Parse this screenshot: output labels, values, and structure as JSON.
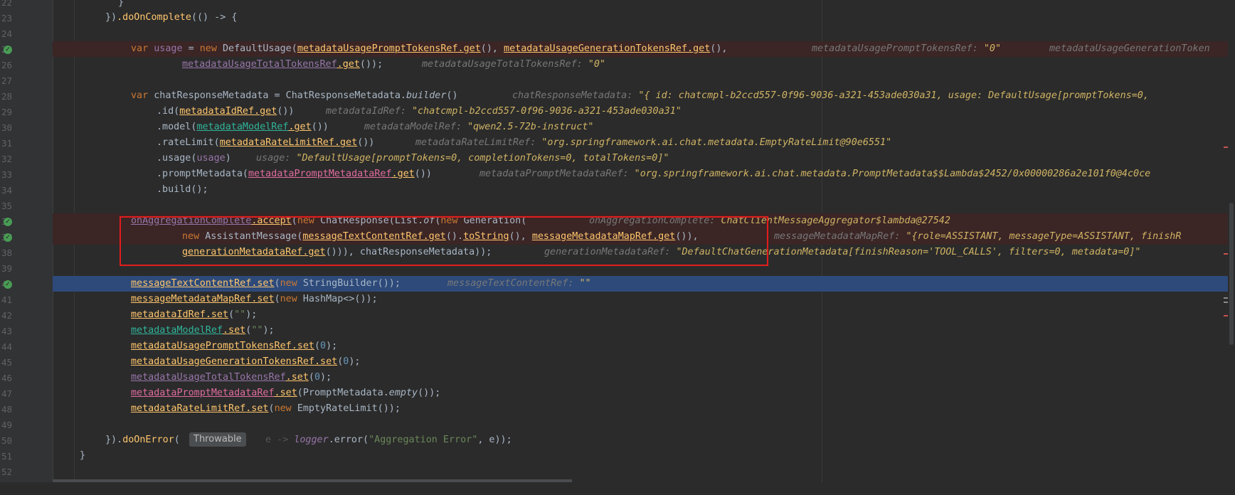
{
  "gutter": {
    "lines": [
      {
        "n": "22",
        "bp": false
      },
      {
        "n": "23",
        "bp": false
      },
      {
        "n": "24",
        "bp": false
      },
      {
        "n": "25",
        "bp": true
      },
      {
        "n": "26",
        "bp": false
      },
      {
        "n": "27",
        "bp": false
      },
      {
        "n": "28",
        "bp": false
      },
      {
        "n": "29",
        "bp": false
      },
      {
        "n": "30",
        "bp": false
      },
      {
        "n": "31",
        "bp": false
      },
      {
        "n": "32",
        "bp": false
      },
      {
        "n": "33",
        "bp": false
      },
      {
        "n": "34",
        "bp": false
      },
      {
        "n": "35",
        "bp": false
      },
      {
        "n": "36",
        "bp": true
      },
      {
        "n": "37",
        "bp": true
      },
      {
        "n": "38",
        "bp": false
      },
      {
        "n": "39",
        "bp": false
      },
      {
        "n": "40",
        "bp": true
      },
      {
        "n": "41",
        "bp": false
      },
      {
        "n": "42",
        "bp": false
      },
      {
        "n": "43",
        "bp": false
      },
      {
        "n": "44",
        "bp": false
      },
      {
        "n": "45",
        "bp": false
      },
      {
        "n": "46",
        "bp": false
      },
      {
        "n": "47",
        "bp": false
      },
      {
        "n": "48",
        "bp": false
      },
      {
        "n": "49",
        "bp": false
      },
      {
        "n": "50",
        "bp": false
      },
      {
        "n": "51",
        "bp": false
      },
      {
        "n": "52",
        "bp": false
      }
    ]
  },
  "code": {
    "l22": "}",
    "l23_a": "})",
    "l23_b": ".doOnComplete",
    "l23_c": "(() -> {",
    "l25_var": "var ",
    "l25_usage": "usage",
    "l25_eq": " = ",
    "l25_new": "new ",
    "l25_cls": "DefaultUsage(",
    "l25_f1": "metadataUsagePromptTokensRef",
    "l25_g1": ".get",
    "l25_p1": "(), ",
    "l25_f2": "metadataUsageGenerationTokensRef",
    "l25_g2": ".get",
    "l25_p2": "(),",
    "l25_h1": "metadataUsagePromptTokensRef: ",
    "l25_v1": "\"0\"",
    "l25_h2": "metadataUsageGenerationToken",
    "l26_f": "metadataUsageTotalTokensRef",
    "l26_g": ".get",
    "l26_p": "());",
    "l26_h": "metadataUsageTotalTokensRef: ",
    "l26_v": "\"0\"",
    "l28_var": "var ",
    "l28_name": "chatResponseMetadata = ChatResponseMetadata.",
    "l28_b": "builder",
    "l28_p": "()",
    "l28_h": "chatResponseMetadata: ",
    "l28_v": "\"{ id: chatcmpl-b2ccd557-0f96-9036-a321-453ade030a31, usage: DefaultUsage[promptTokens=0,",
    "l29_a": ".id(",
    "l29_f": "metadataIdRef",
    "l29_g": ".get",
    "l29_p": "())",
    "l29_h": "metadataIdRef: ",
    "l29_v": "\"chatcmpl-b2ccd557-0f96-9036-a321-453ade030a31\"",
    "l30_a": ".model(",
    "l30_f": "metadataModelRef",
    "l30_g": ".get",
    "l30_p": "())",
    "l30_h": "metadataModelRef: ",
    "l30_v": "\"qwen2.5-72b-instruct\"",
    "l31_a": ".rateLimit(",
    "l31_f": "metadataRateLimitRef",
    "l31_g": ".get",
    "l31_p": "())",
    "l31_h": "metadataRateLimitRef: ",
    "l31_v": "\"org.springframework.ai.chat.metadata.EmptyRateLimit@90e6551\"",
    "l32_a": ".usage(",
    "l32_f": "usage",
    "l32_p": ")",
    "l32_h": "usage: ",
    "l32_v": "\"DefaultUsage[promptTokens=0, completionTokens=0, totalTokens=0]\"",
    "l33_a": ".promptMetadata(",
    "l33_f": "metadataPromptMetadataRef",
    "l33_g": ".get",
    "l33_p": "())",
    "l33_h": "metadataPromptMetadataRef: ",
    "l33_v": "\"org.springframework.ai.chat.metadata.PromptMetadata$$Lambda$2452/0x00000286a2e101f0@4c0ce",
    "l34": ".build();",
    "l36_f": "onAggregationComplete",
    "l36_a": ".accept",
    "l36_b": "(",
    "l36_new": "new ",
    "l36_c": "ChatResponse(List.",
    "l36_of": "of",
    "l36_d": "(",
    "l36_new2": "new ",
    "l36_e": "Generation(",
    "l36_h": "onAggregationComplete: ",
    "l36_v": "ChatClientMessageAggregator$lambda@27542",
    "l37_new": "new ",
    "l37_a": "AssistantMessage(",
    "l37_f1": "messageTextContentRef",
    "l37_g1": ".get",
    "l37_p1": "().",
    "l37_ts": "toString",
    "l37_p2": "(), ",
    "l37_f2": "messageMetadataMapRef",
    "l37_g2": ".get",
    "l37_p3": "()),",
    "l37_h": "messageMetadataMapRef: ",
    "l37_v": "\"{role=ASSISTANT, messageType=ASSISTANT, finishR",
    "l38_f": "generationMetadataRef",
    "l38_g": ".get",
    "l38_p": "())), chatResponseMetadata));",
    "l38_h": "generationMetadataRef: ",
    "l38_v": "\"DefaultChatGenerationMetadata[finishReason='TOOL_CALLS', filters=0, metadata=0]\"",
    "l40_f": "messageTextContentRef",
    "l40_s": ".set",
    "l40_p": "(",
    "l40_new": "new ",
    "l40_c": "StringBuilder());",
    "l40_h": "messageTextContentRef: ",
    "l40_v": "\"\"",
    "l41_f": "messageMetadataMapRef",
    "l41_s": ".set",
    "l41_p": "(",
    "l41_new": "new ",
    "l41_c": "HashMap<>());",
    "l42_f": "metadataIdRef",
    "l42_s": ".set",
    "l42_p": "(",
    "l42_str": "\"\"",
    "l42_e": ");",
    "l43_f": "metadataModelRef",
    "l43_s": ".set",
    "l43_p": "(",
    "l43_str": "\"\"",
    "l43_e": ");",
    "l44_f": "metadataUsagePromptTokensRef",
    "l44_s": ".set",
    "l44_p": "(",
    "l44_n": "0",
    "l44_e": ");",
    "l45_f": "metadataUsageGenerationTokensRef",
    "l45_s": ".set",
    "l45_p": "(",
    "l45_n": "0",
    "l45_e": ");",
    "l46_f": "metadataUsageTotalTokensRef",
    "l46_s": ".set",
    "l46_p": "(",
    "l46_n": "0",
    "l46_e": ");",
    "l47_f": "metadataPromptMetadataRef",
    "l47_s": ".set",
    "l47_p": "(PromptMetadata.",
    "l47_em": "empty",
    "l47_e": "());",
    "l48_f": "metadataRateLimitRef",
    "l48_s": ".set",
    "l48_p": "(",
    "l48_new": "new ",
    "l48_c": "EmptyRateLimit());",
    "l50_a": "}).",
    "l50_b": "doOnError",
    "l50_c": "(",
    "l50_e": "e -> ",
    "l50_lg": "logger",
    "l50_d": ".error(",
    "l50_str": "\"Aggregation Error\"",
    "l50_f": ", e));",
    "l51": "}"
  },
  "tooltip": {
    "text": "Throwable"
  },
  "colors": {
    "highlight_box": "#e21d1d",
    "current_line": "#2d4a7a",
    "breakpoint": "#499c54"
  }
}
